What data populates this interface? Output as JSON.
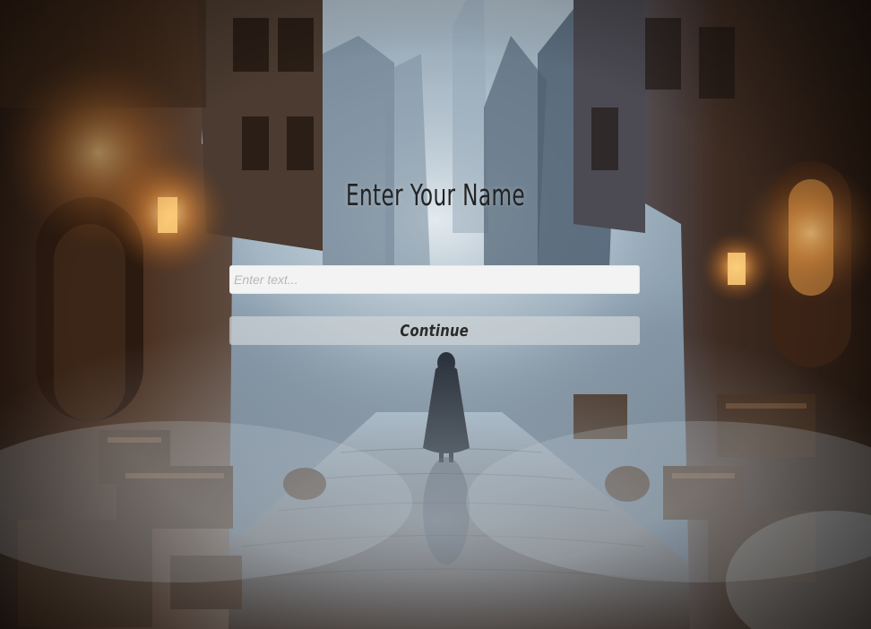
{
  "prompt": {
    "title": "Enter Your Name"
  },
  "name_input": {
    "placeholder": "Enter text...",
    "value": ""
  },
  "continue_button": {
    "label": "Continue"
  },
  "colors": {
    "fog": "#b9c9d6",
    "lantern_glow": "#f2a24a",
    "stone": "#6b5b4f",
    "wood": "#3a2619",
    "button_bg": "#cdd2d6",
    "input_bg": "#f3f3f3"
  }
}
